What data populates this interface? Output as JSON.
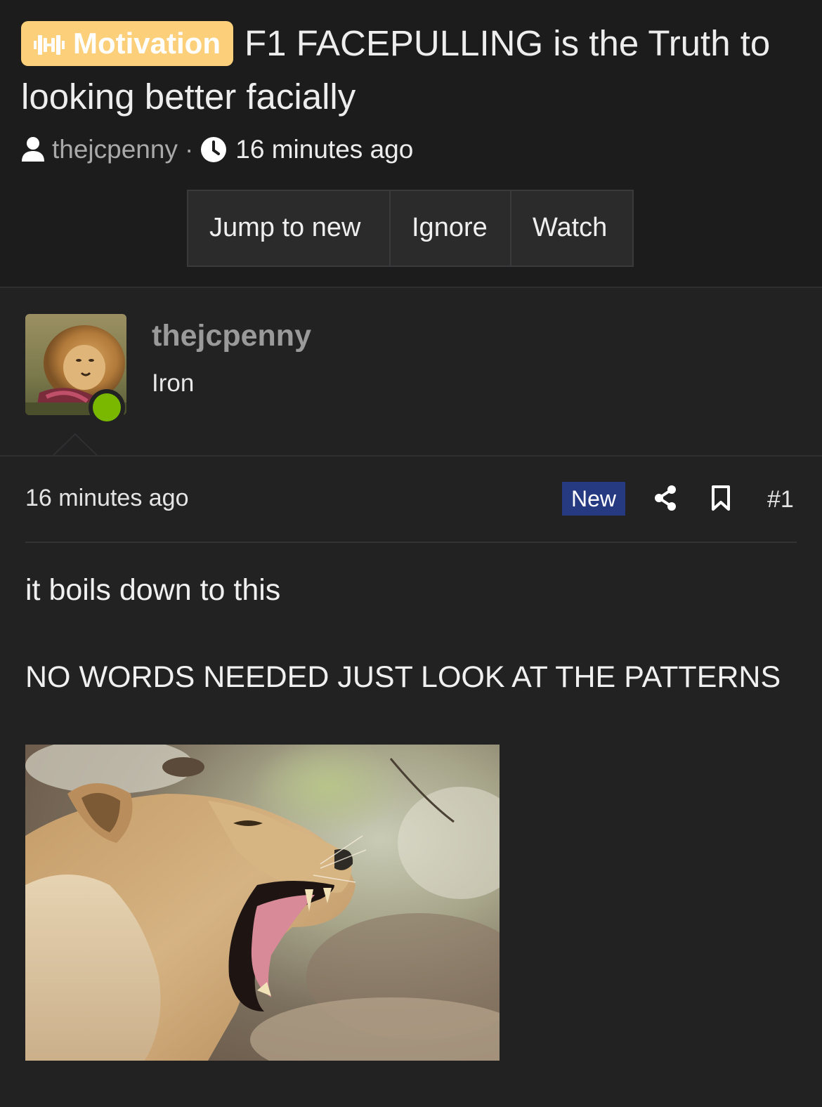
{
  "thread": {
    "prefix_label": "Motivation",
    "prefix_icon": "dumbbell-icon",
    "title": "F1 FACEPULLING is the Truth to looking better facially",
    "author": "thejcpenny",
    "separator": "·",
    "time": "16 minutes ago",
    "actions": {
      "jump": "Jump to new",
      "ignore": "Ignore",
      "watch": "Watch"
    }
  },
  "post": {
    "username": "thejcpenny",
    "user_title": "Iron",
    "online": true,
    "time": "16 minutes ago",
    "new_badge": "New",
    "number": "#1",
    "line1": "it boils down to this",
    "line2": "NO WORDS NEEDED JUST LOOK AT THE PATTERNS",
    "image_subject": "lioness roaring photo",
    "avatar_subject": "male lion eating"
  },
  "colors": {
    "background": "#222223",
    "header_background": "#1c1c1d",
    "prefix_badge": "#fccf7a",
    "new_badge": "#253a80",
    "online_dot": "#7ab800"
  }
}
